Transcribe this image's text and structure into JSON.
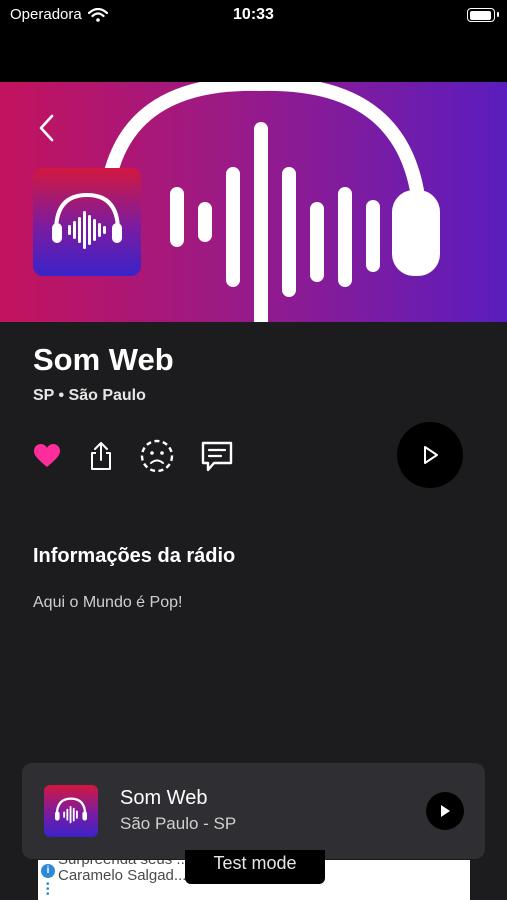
{
  "status_bar": {
    "carrier": "Operadora",
    "time": "10:33",
    "wifi_icon": "wifi-icon",
    "battery_icon": "battery-icon",
    "battery_level": 1.0
  },
  "header": {
    "back_icon": "chevron-left-icon",
    "hero_art": "headphones-waveform-art",
    "logo": "headphones-waveform-logo"
  },
  "station": {
    "name": "Som Web",
    "subtitle": "SP • São Paulo"
  },
  "actions": {
    "favorite_icon": "heart-icon",
    "share_icon": "share-icon",
    "report_icon": "sad-face-icon",
    "comment_icon": "message-icon",
    "play_icon": "play-icon",
    "favorite_color": "#ff2d9c",
    "play_bg": "#000000"
  },
  "info": {
    "title": "Informações da rádio",
    "description": "Aqui o Mundo é Pop!"
  },
  "mini_player": {
    "name": "Som Web",
    "location": "São Paulo - SP",
    "play_icon": "play-icon"
  },
  "ad_banner": {
    "text_line1": "Surpreenda seus ... Dulce de Leche",
    "text_line2": "Caramelo Salgad... nas lojas",
    "badge": "Test mode",
    "info_icon": "info-icon"
  },
  "colors": {
    "hero_left": "#c3135e",
    "hero_right": "#5a1dbf",
    "background": "#1c1c1e",
    "mini_bg": "#2f2f33"
  }
}
